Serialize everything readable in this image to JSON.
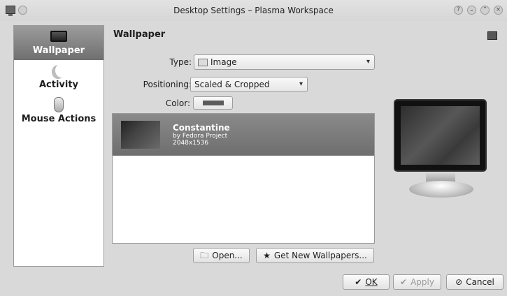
{
  "window": {
    "title": "Desktop Settings – Plasma Workspace",
    "controls": [
      "?",
      "⌄",
      "⌃",
      "×"
    ]
  },
  "sidebar": {
    "items": [
      {
        "label": "Wallpaper",
        "icon": "monitor-icon",
        "active": true
      },
      {
        "label": "Activity",
        "icon": "activity-icon",
        "active": false
      },
      {
        "label": "Mouse Actions",
        "icon": "mouse-icon",
        "active": false
      }
    ]
  },
  "main": {
    "section_title": "Wallpaper",
    "type": {
      "label": "Type:",
      "value": "Image"
    },
    "positioning": {
      "label": "Positioning:",
      "value": "Scaled & Cropped"
    },
    "color": {
      "label": "Color:",
      "value": "#5a5a5a"
    },
    "wallpapers": [
      {
        "name": "Constantine",
        "author": "by Fedora Project",
        "resolution": "2048x1536",
        "selected": true
      }
    ],
    "open_button": "Open...",
    "get_new_button": "Get New Wallpapers..."
  },
  "footer": {
    "ok": "OK",
    "apply": "Apply",
    "cancel": "Cancel"
  }
}
